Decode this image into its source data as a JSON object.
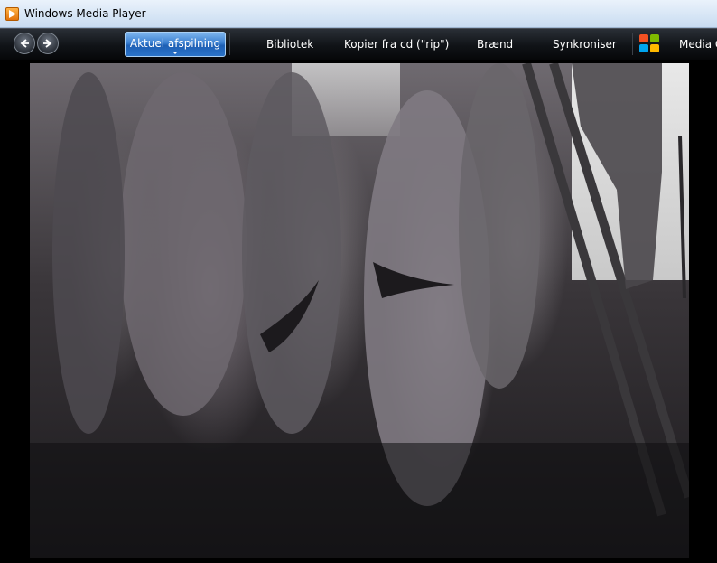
{
  "window": {
    "title": "Windows Media Player"
  },
  "nav": {
    "tabs": [
      {
        "label": "Aktuel afspilning",
        "active": true
      },
      {
        "label": "Bibliotek",
        "active": false
      },
      {
        "label": "Kopier fra cd (\"rip\")",
        "active": false
      },
      {
        "label": "Brænd",
        "active": false
      },
      {
        "label": "Synkroniser",
        "active": false
      },
      {
        "label": "Media G",
        "active": false
      }
    ]
  },
  "icons": {
    "app": "media-player-icon",
    "back": "back-arrow-icon",
    "forward": "forward-arrow-icon",
    "store": "windows-logo-icon"
  },
  "colors": {
    "active_tab": "#2b73c8",
    "navbar": "#101317",
    "titlebar": "#d6e5f5"
  }
}
